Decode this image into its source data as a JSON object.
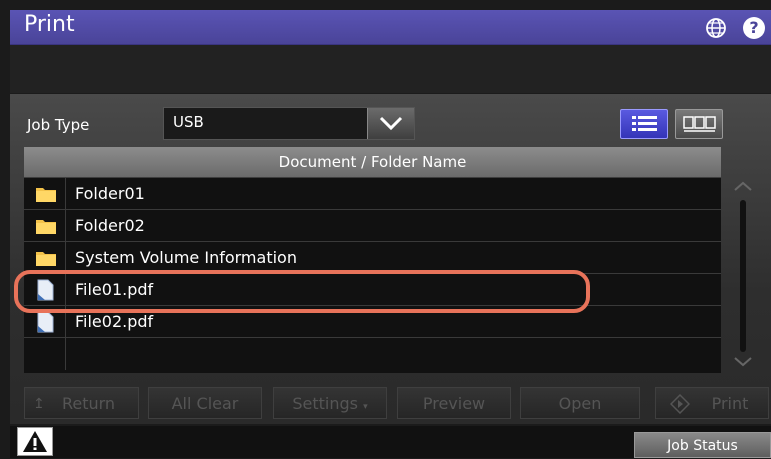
{
  "window": {
    "title": "Print"
  },
  "job_type": {
    "label": "Job Type",
    "value": "USB"
  },
  "table": {
    "header": "Document / Folder Name",
    "rows": [
      {
        "type": "folder",
        "name": "Folder01"
      },
      {
        "type": "folder",
        "name": "Folder02"
      },
      {
        "type": "folder",
        "name": "System Volume Information"
      },
      {
        "type": "file",
        "name": "File01.pdf"
      },
      {
        "type": "file",
        "name": "File02.pdf"
      }
    ]
  },
  "buttons": {
    "return": "Return",
    "all_clear": "All Clear",
    "settings": "Settings",
    "preview": "Preview",
    "open": "Open",
    "print": "Print"
  },
  "status": {
    "job_status": "Job Status"
  },
  "colors": {
    "accent": "#4a4499",
    "highlight": "#e8735a"
  }
}
